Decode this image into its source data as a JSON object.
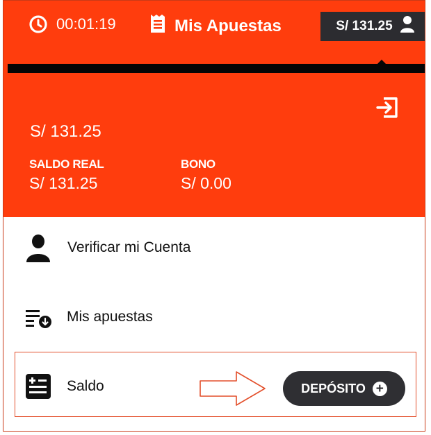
{
  "header": {
    "timer": "00:01:19",
    "title": "Mis Apuestas",
    "balance_chip": "S/ 131.25"
  },
  "account": {
    "total_balance": "S/ 131.25",
    "real_balance_label": "SALDO REAL",
    "real_balance_value": "S/ 131.25",
    "bonus_label": "BONO",
    "bonus_value": "S/ 0.00"
  },
  "menu": {
    "verify_label": "Verificar mi Cuenta",
    "my_bets_label": "Mis apuestas",
    "balance_label": "Saldo",
    "deposit_label": "DEPÓSITO",
    "deposit_plus": "+"
  },
  "colors": {
    "brand": "#ff3d0d",
    "dark": "#2c2c30",
    "highlight_border": "#e34e2a"
  },
  "icons": [
    "clock-icon",
    "receipt-icon",
    "user-icon",
    "logout-icon",
    "user-silhouette-icon",
    "bet-list-icon",
    "balance-sheet-icon",
    "arrow-right-icon",
    "plus-icon"
  ]
}
